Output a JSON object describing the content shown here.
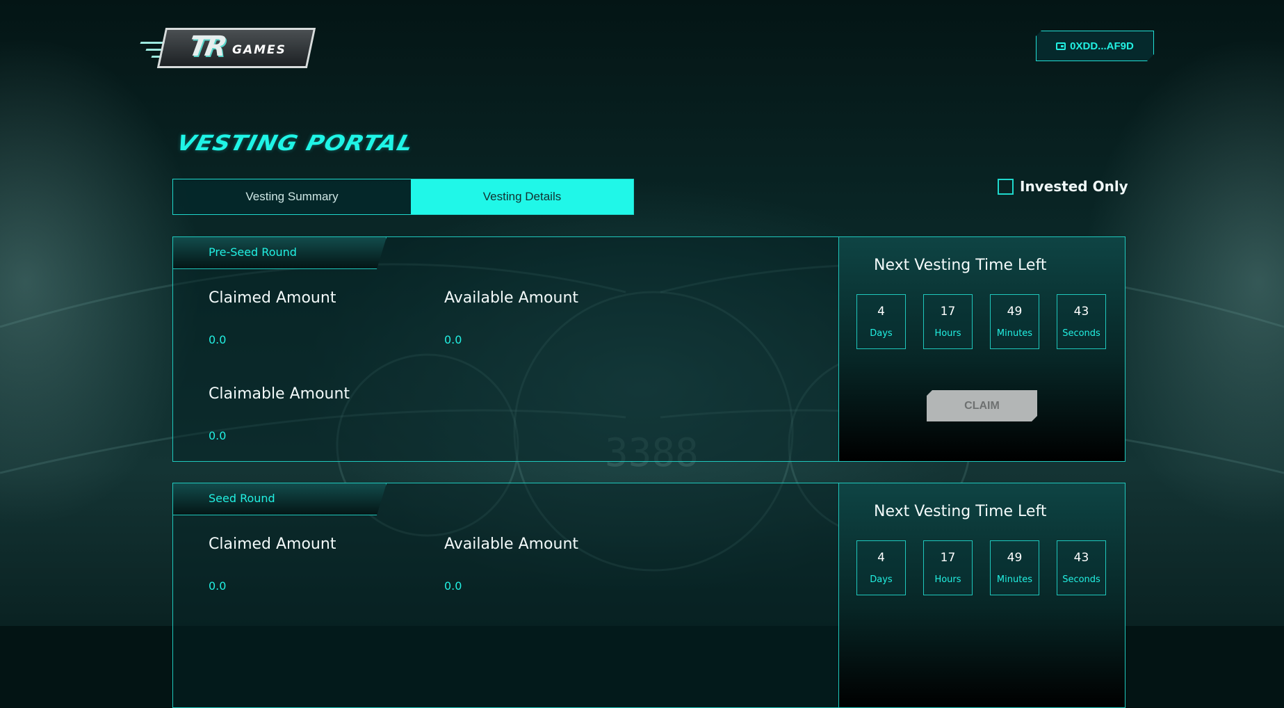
{
  "header": {
    "logo_text_main": "TR",
    "logo_text_sub": "GAMES",
    "wallet_address": "0XDD...AF9D"
  },
  "page": {
    "title": "VESTING PORTAL",
    "tabs": [
      {
        "label": "Vesting Summary",
        "active": false
      },
      {
        "label": "Vesting Details",
        "active": true
      }
    ],
    "invested_only": {
      "label": "Invested Only",
      "checked": false
    }
  },
  "rounds": [
    {
      "name": "Pre-Seed Round",
      "claimed_label": "Claimed Amount",
      "claimed_value": "0.0",
      "available_label": "Available Amount",
      "available_value": "0.0",
      "claimable_label": "Claimable Amount",
      "claimable_value": "0.0",
      "timer_title": "Next Vesting Time Left",
      "timer": [
        {
          "value": "4",
          "unit": "Days"
        },
        {
          "value": "17",
          "unit": "Hours"
        },
        {
          "value": "49",
          "unit": "Minutes"
        },
        {
          "value": "43",
          "unit": "Seconds"
        }
      ],
      "claim_label": "CLAIM"
    },
    {
      "name": "Seed Round",
      "claimed_label": "Claimed Amount",
      "claimed_value": "0.0",
      "available_label": "Available Amount",
      "available_value": "0.0",
      "timer_title": "Next Vesting Time Left",
      "timer": [
        {
          "value": "4",
          "unit": "Days"
        },
        {
          "value": "17",
          "unit": "Hours"
        },
        {
          "value": "49",
          "unit": "Minutes"
        },
        {
          "value": "43",
          "unit": "Seconds"
        }
      ]
    }
  ],
  "colors": {
    "accent": "#20F7E8",
    "background": "#031414",
    "disabled_button": "#B3B6B6"
  }
}
